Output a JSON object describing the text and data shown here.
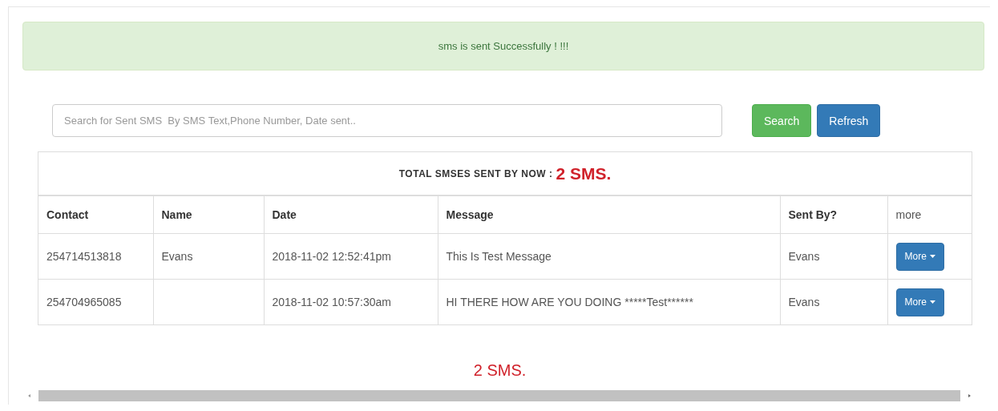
{
  "alert": {
    "message": "sms is sent Successfully ! !!!"
  },
  "search": {
    "placeholder": "Search for Sent SMS  By SMS Text,Phone Number, Date sent..",
    "buttons": [
      {
        "label": "Search",
        "kind": "success"
      },
      {
        "label": "Refresh",
        "kind": "primary"
      }
    ]
  },
  "table": {
    "title": "TOTAL SMSES SENT BY NOW :",
    "total": "2 SMS.",
    "columns": [
      "Contact",
      "Name",
      "Date",
      "Message",
      "Sent By?",
      "more"
    ],
    "rows": [
      {
        "contact": "254714513818",
        "name": "Evans",
        "date": "2018-11-02 12:52:41pm",
        "message": "This Is Test Message",
        "sent_by": "Evans",
        "action": "More"
      },
      {
        "contact": "254704965085",
        "date": "2018-11-02 10:57:30am",
        "message": "HI THERE HOW ARE YOU DOING *****Test******",
        "sent_by": "Evans",
        "action": "More"
      }
    ]
  },
  "footer_count": "2 SMS."
}
